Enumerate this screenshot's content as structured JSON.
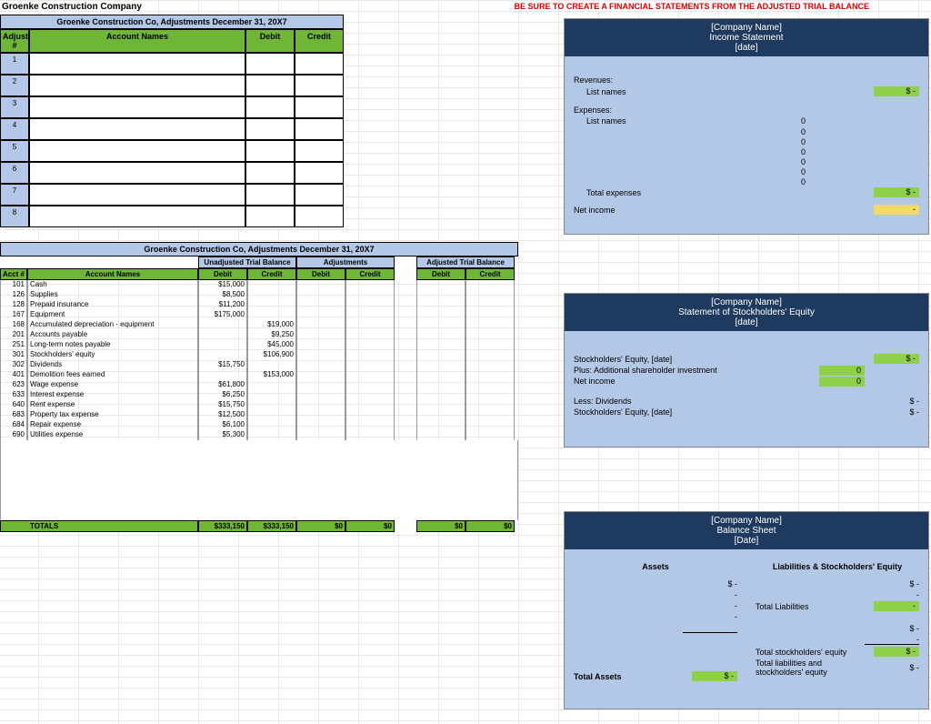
{
  "page_title": "Groenke Construction Company",
  "warning": "BE SURE TO CREATE A FINANCIAL STATEMENTS FROM THE ADJUSTED TRIAL BALANCE",
  "adjustments_table": {
    "title": "Groenke Construction Co,  Adjustments December 31, 20X7",
    "headers": {
      "adjust": "Adjust #",
      "account": "Account Names",
      "debit": "Debit",
      "credit": "Credit"
    },
    "rows": [
      "1",
      "2",
      "3",
      "4",
      "5",
      "6",
      "7",
      "8"
    ]
  },
  "trial_balance": {
    "title": "Groenke Construction Co,  Adjustments December 31, 20X7",
    "subheaders": {
      "utb": "Unadjusted Trial Balance",
      "adj": "Adjustments",
      "atb": "Adjusted Trial Balance"
    },
    "cols": {
      "acct": "Acct #",
      "name": "Account Names",
      "debit": "Debit",
      "credit": "Credit"
    },
    "accounts": [
      {
        "n": "101",
        "name": "Cash",
        "ud": "$15,000"
      },
      {
        "n": "126",
        "name": "Supplies",
        "ud": "$8,500"
      },
      {
        "n": "128",
        "name": "Prepaid insurance",
        "ud": "$11,200"
      },
      {
        "n": "167",
        "name": "Equipment",
        "ud": "$175,000"
      },
      {
        "n": "168",
        "name": "Accumulated depreciation - equipment",
        "uc": "$19,000"
      },
      {
        "n": "201",
        "name": "Accounts payable",
        "uc": "$9,250"
      },
      {
        "n": "251",
        "name": "Long-term notes payable",
        "uc": "$45,000"
      },
      {
        "n": "301",
        "name": "Stockholders' equity",
        "uc": "$106,900"
      },
      {
        "n": "302",
        "name": "Dividends",
        "ud": "$15,750"
      },
      {
        "n": "401",
        "name": "Demolition fees earned",
        "uc": "$153,000"
      },
      {
        "n": "623",
        "name": "Wage expense",
        "ud": "$61,800"
      },
      {
        "n": "633",
        "name": "Interest expense",
        "ud": "$6,250"
      },
      {
        "n": "640",
        "name": "Rent expense",
        "ud": "$15,750"
      },
      {
        "n": "683",
        "name": "Property tax expense",
        "ud": "$12,500"
      },
      {
        "n": "684",
        "name": "Repair expense",
        "ud": "$6,100"
      },
      {
        "n": "690",
        "name": "Utilities expense",
        "ud": "$5,300"
      }
    ],
    "totals": {
      "label": "TOTALS",
      "ud": "$333,150",
      "uc": "$333,150",
      "ad": "$0",
      "ac": "$0",
      "td": "$0",
      "tc": "$0"
    }
  },
  "income_statement": {
    "title_l1": "[Company Name]",
    "title_l2": "Income Statement",
    "title_l3": "[date]",
    "labels": {
      "rev": "Revenues:",
      "list": "List names",
      "exp": "Expenses:",
      "totexp": "Total expenses",
      "ni": "Net income"
    },
    "dash": "$    -",
    "dash_plain": "-",
    "zeros": [
      "0",
      "0",
      "0",
      "0",
      "0",
      "0",
      "0"
    ]
  },
  "sse": {
    "title_l1": "[Company Name]",
    "title_l2": "Statement of Stockholders' Equity",
    "title_l3": "[date]",
    "labels": {
      "beg": "Stockholders' Equity, [date]",
      "plus": "Plus: Additional shareholder investment",
      "ni": "Net income",
      "less": "Less: Dividends",
      "end": "Stockholders' Equity, [date]"
    },
    "dash": "$  -",
    "dash2": "$    -",
    "zero1": "0",
    "zero2": "0"
  },
  "balance_sheet": {
    "title_l1": "[Company Name]",
    "title_l2": "Balance Sheet",
    "title_l3": "[Date]",
    "labels": {
      "assets": "Assets",
      "liab": "Liabilities & Stockholders' Equity",
      "ta": "Total Assets",
      "tl": "Total Liabilities",
      "tse": "Total stockholders' equity",
      "tlse": "Total liabilities and stockholders' equity"
    },
    "dash": "$    -",
    "dashes": [
      "-",
      "-",
      "-"
    ],
    "sdash": "$       -"
  },
  "chart_data": {
    "type": "table",
    "title": "Unadjusted Trial Balance — Groenke Construction Co, December 31, 20X7",
    "columns": [
      "Acct #",
      "Account Name",
      "Debit",
      "Credit"
    ],
    "rows": [
      [
        101,
        "Cash",
        15000,
        null
      ],
      [
        126,
        "Supplies",
        8500,
        null
      ],
      [
        128,
        "Prepaid insurance",
        11200,
        null
      ],
      [
        167,
        "Equipment",
        175000,
        null
      ],
      [
        168,
        "Accumulated depreciation - equipment",
        null,
        19000
      ],
      [
        201,
        "Accounts payable",
        null,
        9250
      ],
      [
        251,
        "Long-term notes payable",
        null,
        45000
      ],
      [
        301,
        "Stockholders' equity",
        null,
        106900
      ],
      [
        302,
        "Dividends",
        15750,
        null
      ],
      [
        401,
        "Demolition fees earned",
        null,
        153000
      ],
      [
        623,
        "Wage expense",
        61800,
        null
      ],
      [
        633,
        "Interest expense",
        6250,
        null
      ],
      [
        640,
        "Rent expense",
        15750,
        null
      ],
      [
        683,
        "Property tax expense",
        12500,
        null
      ],
      [
        684,
        "Repair expense",
        6100,
        null
      ],
      [
        690,
        "Utilities expense",
        5300,
        null
      ]
    ],
    "totals": {
      "debit": 333150,
      "credit": 333150
    }
  }
}
